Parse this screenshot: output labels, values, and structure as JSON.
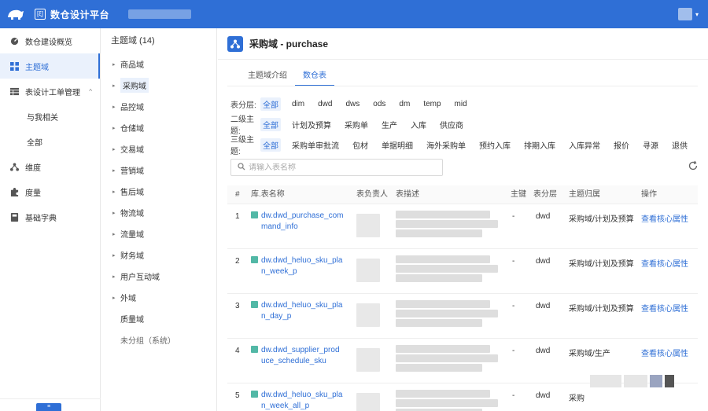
{
  "app": {
    "title": "数仓设计平台",
    "brand_mark": "[ξ]"
  },
  "nav": {
    "items": [
      {
        "id": "overview",
        "label": "数仓建设概览",
        "icon": "gauge-icon"
      },
      {
        "id": "subject",
        "label": "主题域",
        "icon": "grid-icon",
        "active": true
      },
      {
        "id": "tickets",
        "label": "表设计工单管理",
        "icon": "table-icon",
        "expanded": true
      },
      {
        "id": "mine",
        "label": "与我相关",
        "sub": true
      },
      {
        "id": "all",
        "label": "全部",
        "sub": true
      },
      {
        "id": "dimension",
        "label": "维度",
        "icon": "hierarchy-icon"
      },
      {
        "id": "measure",
        "label": "度量",
        "icon": "puzzle-icon"
      },
      {
        "id": "dict",
        "label": "基础字典",
        "icon": "book-icon"
      }
    ]
  },
  "tree": {
    "title": "主题域 (14)",
    "items": [
      {
        "label": "商品域",
        "has_children": true
      },
      {
        "label": "采购域",
        "has_children": true,
        "active": true
      },
      {
        "label": "品控域",
        "has_children": true
      },
      {
        "label": "仓储域",
        "has_children": true
      },
      {
        "label": "交易域",
        "has_children": true
      },
      {
        "label": "营销域",
        "has_children": true
      },
      {
        "label": "售后域",
        "has_children": true
      },
      {
        "label": "物流域",
        "has_children": true
      },
      {
        "label": "流量域",
        "has_children": true
      },
      {
        "label": "财务域",
        "has_children": true
      },
      {
        "label": "用户互动域",
        "has_children": true
      },
      {
        "label": "外域",
        "has_children": true
      },
      {
        "label": "质量域",
        "has_children": false
      },
      {
        "label": "未分组（系统）",
        "has_children": false,
        "muted": true
      }
    ]
  },
  "main": {
    "title": "采购域 - purchase",
    "tabs": [
      {
        "label": "主题域介绍"
      },
      {
        "label": "数仓表",
        "active": true
      }
    ],
    "filters": [
      {
        "label": "表分层:",
        "options": [
          "全部",
          "dim",
          "dwd",
          "dws",
          "ods",
          "dm",
          "temp",
          "mid"
        ],
        "selected": 0
      },
      {
        "label": "二级主题:",
        "options": [
          "全部",
          "计划及预算",
          "采购单",
          "生产",
          "入库",
          "供应商"
        ],
        "selected": 0
      },
      {
        "label": "三级主题:",
        "options": [
          "全部",
          "采购单审批流",
          "包材",
          "单据明细",
          "海外采购单",
          "预约入库",
          "排期入库",
          "入库异常",
          "报价",
          "寻源",
          "退供"
        ],
        "selected": 0
      }
    ],
    "search": {
      "placeholder": "请输入表名称"
    },
    "table": {
      "headers": {
        "index": "#",
        "name": "库.表名称",
        "owner": "表负责人",
        "desc": "表描述",
        "pk": "主键",
        "layer": "表分层",
        "domain": "主题归属",
        "action": "操作"
      },
      "rows": [
        {
          "index": "1",
          "name_l1": "dw.dwd_purchase_com",
          "name_l2": "mand_info",
          "pk": "-",
          "layer": "dwd",
          "domain": "采购域/计划及预算",
          "action": "查看核心属性"
        },
        {
          "index": "2",
          "name_l1": "dw.dwd_heluo_sku_pla",
          "name_l2": "n_week_p",
          "pk": "-",
          "layer": "dwd",
          "domain": "采购域/计划及预算",
          "action": "查看核心属性"
        },
        {
          "index": "3",
          "name_l1": "dw.dwd_heluo_sku_pla",
          "name_l2": "n_day_p",
          "pk": "-",
          "layer": "dwd",
          "domain": "采购域/计划及预算",
          "action": "查看核心属性"
        },
        {
          "index": "4",
          "name_l1": "dw.dwd_supplier_prod",
          "name_l2": "uce_schedule_sku",
          "pk": "-",
          "layer": "dwd",
          "domain": "采购域/生产",
          "action": "查看核心属性"
        },
        {
          "index": "5",
          "name_l1": "dw.dwd_heluo_sku_pla",
          "name_l2": "n_week_all_p",
          "pk": "-",
          "layer": "dwd",
          "domain": "采购",
          "action": ""
        }
      ]
    }
  },
  "colors": {
    "primary": "#2f6fd6",
    "table_icon": "#52b8a6"
  }
}
